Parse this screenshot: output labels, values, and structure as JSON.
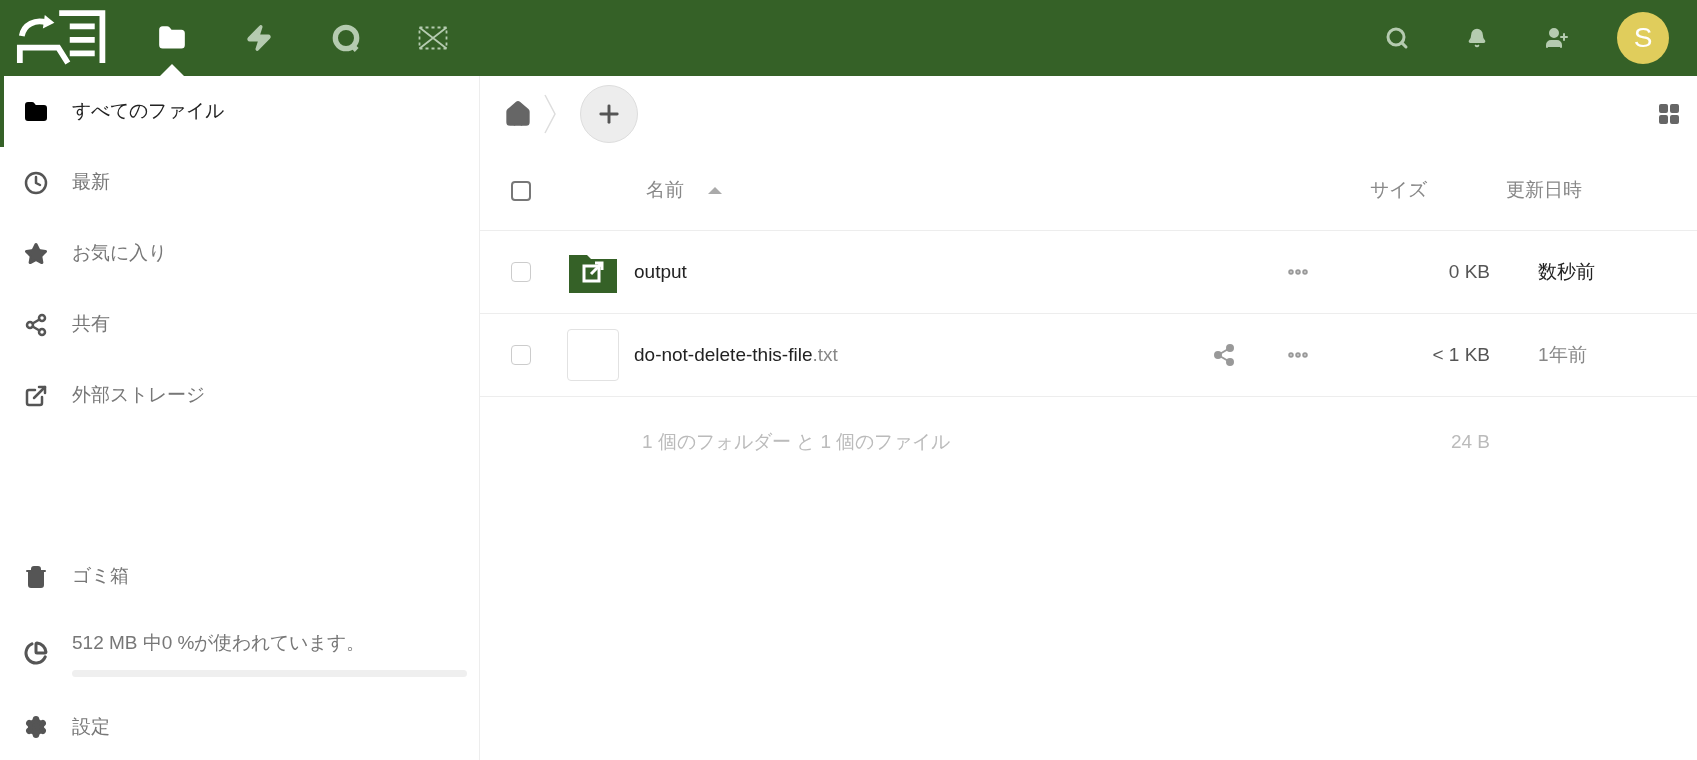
{
  "header": {
    "apps": [
      {
        "kind": "files",
        "selected": true
      },
      {
        "kind": "activity",
        "selected": false
      },
      {
        "kind": "talk",
        "selected": false
      },
      {
        "kind": "expand",
        "selected": false
      }
    ],
    "avatar": "S"
  },
  "sidebar": {
    "items": [
      {
        "kind": "folder",
        "label": "すべてのファイル",
        "selected": true
      },
      {
        "kind": "clock",
        "label": "最新",
        "selected": false
      },
      {
        "kind": "star",
        "label": "お気に入り",
        "selected": false
      },
      {
        "kind": "share",
        "label": "共有",
        "selected": false
      },
      {
        "kind": "external",
        "label": "外部ストレージ",
        "selected": false
      }
    ],
    "bottom_items": [
      {
        "kind": "trash",
        "label": "ゴミ箱",
        "selected": false
      }
    ],
    "quota": {
      "text": "512 MB 中0 %が使われています。",
      "level": 0
    },
    "settings": {
      "label": "設定"
    }
  },
  "table": {
    "select_all": {
      "checked": false
    },
    "columns": [
      {
        "label": "名前",
        "sorted": true
      },
      {
        "label": "サイズ",
        "sorted": false
      },
      {
        "label": "更新日時",
        "sorted": false
      }
    ],
    "rows": [
      {
        "kind": "folder",
        "name": "output",
        "extension": "",
        "shared": false,
        "checked": false,
        "size": "0 KB",
        "modified": "数秒前",
        "recent": true
      },
      {
        "kind": "file",
        "name": "do-not-delete-this-file",
        "extension": ".txt",
        "shared": true,
        "checked": false,
        "size": "< 1 KB",
        "modified": "1年前",
        "recent": false
      }
    ],
    "summary": {
      "text": "1 個のフォルダー と 1 個のファイル",
      "size": "24 B"
    }
  }
}
